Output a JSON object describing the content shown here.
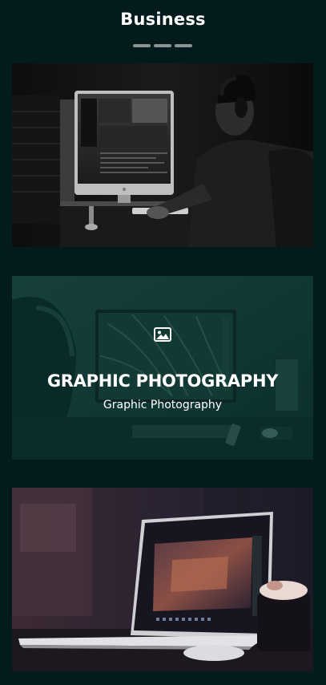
{
  "section": {
    "title": "Business"
  },
  "portfolio": {
    "items": [
      {
        "kind": "image",
        "icon": "image-icon",
        "title": "",
        "subtitle": ""
      },
      {
        "kind": "image",
        "icon": "image-icon",
        "title": "GRAPHIC PHOTOGRAPHY",
        "subtitle": "Graphic Photography",
        "hover": true
      },
      {
        "kind": "image",
        "icon": "image-icon",
        "title": "",
        "subtitle": ""
      }
    ]
  },
  "colors": {
    "background": "#031b1c",
    "overlay": "#083834",
    "divider": "#8a9393",
    "text": "#ffffff"
  }
}
